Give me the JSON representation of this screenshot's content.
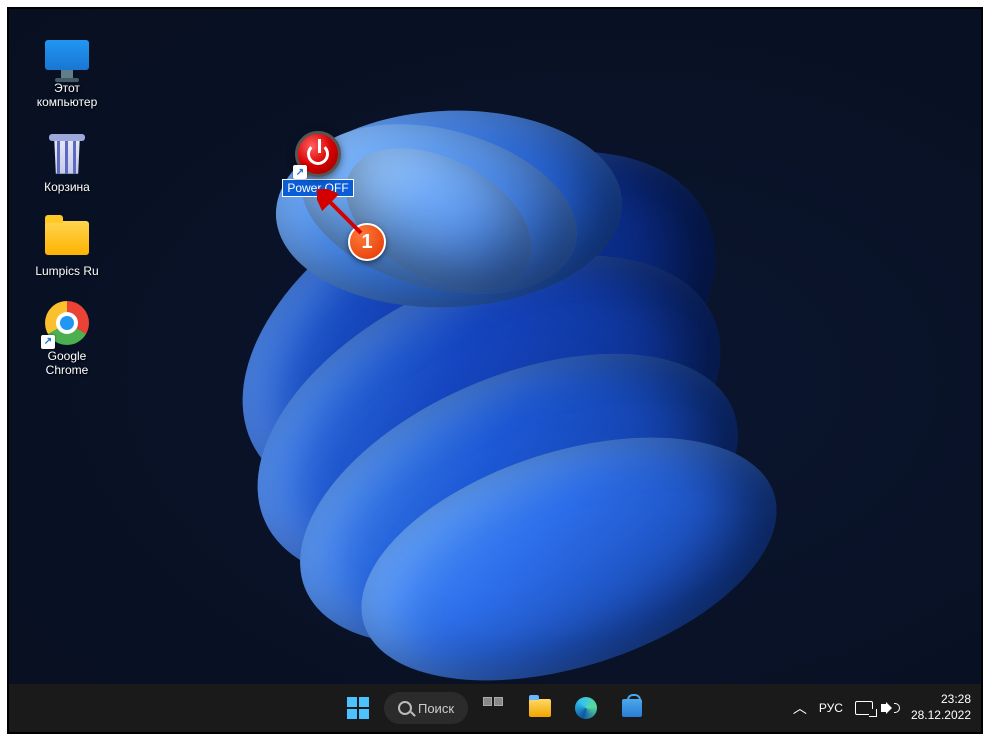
{
  "desktop": {
    "icons": [
      {
        "label": "Этот\nкомпьютер"
      },
      {
        "label": "Корзина"
      },
      {
        "label": "Lumpics Ru"
      },
      {
        "label": "Google\nChrome"
      }
    ],
    "power_icon": {
      "label": "Power OFF"
    }
  },
  "annotation": {
    "number": "1"
  },
  "taskbar": {
    "search_label": "Поиск",
    "tray": {
      "lang": "РУС"
    },
    "clock": {
      "time": "23:28",
      "date": "28.12.2022"
    }
  }
}
